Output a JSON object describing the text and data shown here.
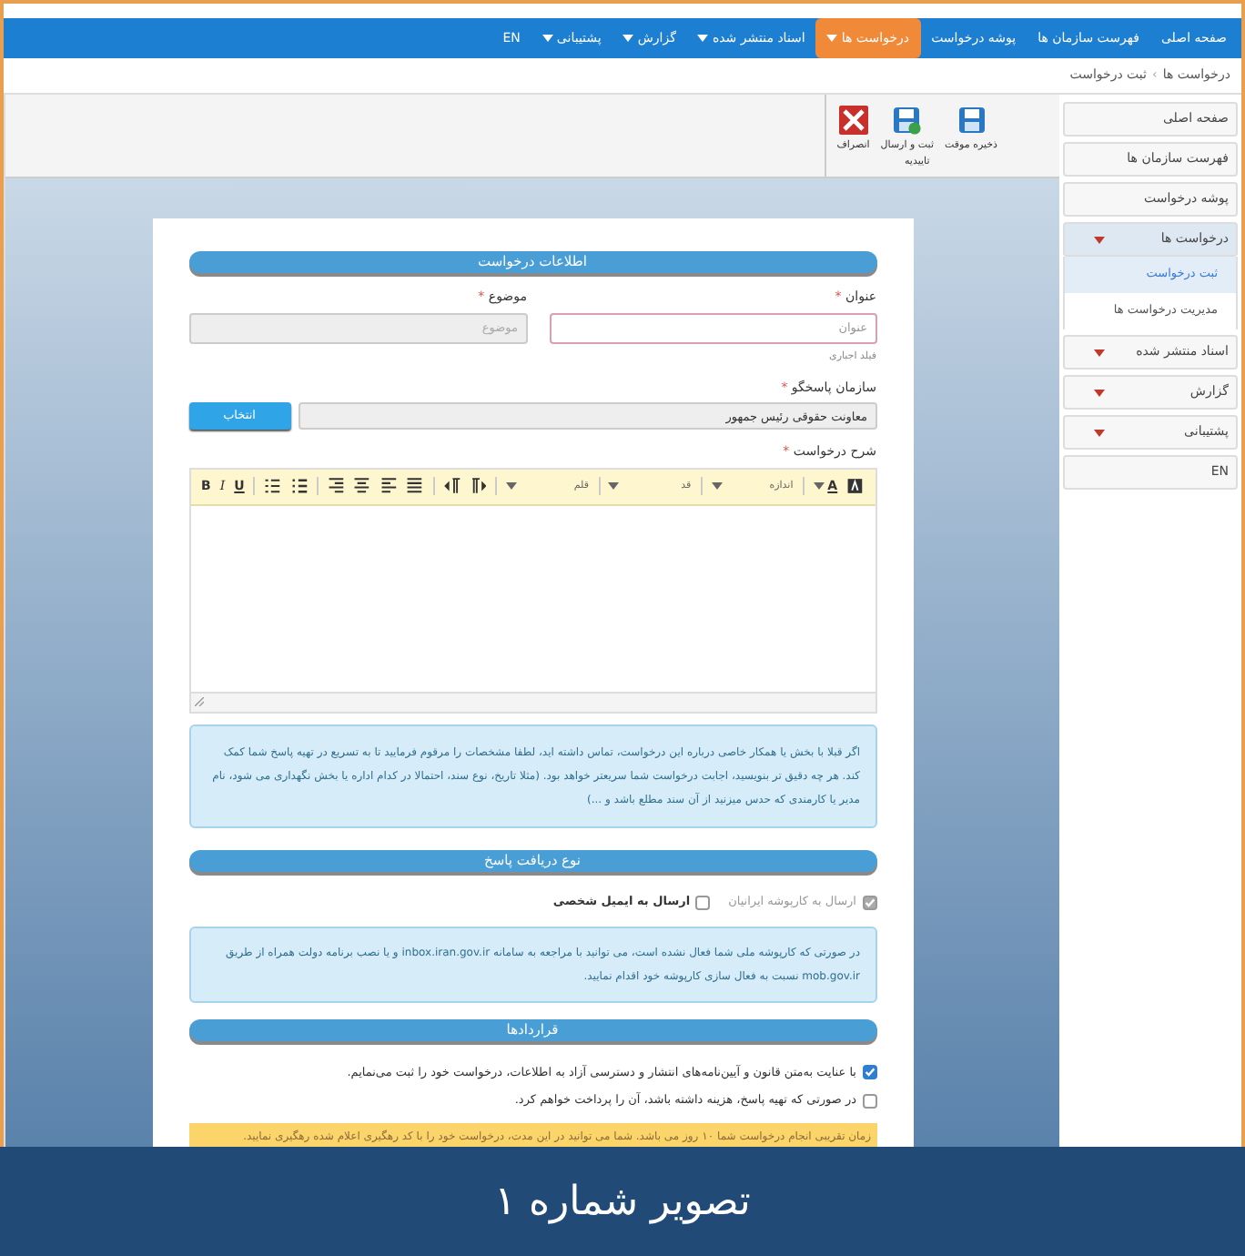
{
  "nav": {
    "items": [
      {
        "label": "صفحه اصلی",
        "dropdown": false,
        "selected": false
      },
      {
        "label": "فهرست سازمان ها",
        "dropdown": false,
        "selected": false
      },
      {
        "label": "پوشه درخواست",
        "dropdown": false,
        "selected": false
      },
      {
        "label": "درخواست ها",
        "dropdown": true,
        "selected": true
      },
      {
        "label": "اسناد منتشر شده",
        "dropdown": true,
        "selected": false
      },
      {
        "label": "گزارش",
        "dropdown": true,
        "selected": false
      },
      {
        "label": "پشتیبانی",
        "dropdown": true,
        "selected": false
      },
      {
        "label": "EN",
        "dropdown": false,
        "selected": false
      }
    ]
  },
  "breadcrumb": {
    "items": [
      "درخواست ها",
      "ثبت درخواست"
    ],
    "separator": "›"
  },
  "toolbar": {
    "buttons": [
      {
        "label": "ذخیره موقت",
        "kind": "save"
      },
      {
        "label": "ثبت و ارسال",
        "kind": "send"
      },
      {
        "label": "انصراف",
        "kind": "cancel"
      }
    ],
    "group_label": "تاییدیه"
  },
  "sidebar": {
    "items": [
      {
        "label": "صفحه اصلی",
        "expanded": false,
        "dropdown": false
      },
      {
        "label": "فهرست سازمان ها",
        "expanded": false,
        "dropdown": false
      },
      {
        "label": "پوشه درخواست",
        "expanded": false,
        "dropdown": false
      },
      {
        "label": "درخواست ها",
        "expanded": true,
        "dropdown": true,
        "children": [
          {
            "label": "ثبت درخواست",
            "selected": true
          },
          {
            "label": "مدیریت درخواست ها",
            "selected": false
          }
        ]
      },
      {
        "label": "اسناد منتشر شده",
        "expanded": false,
        "dropdown": true
      },
      {
        "label": "گزارش",
        "expanded": false,
        "dropdown": true
      },
      {
        "label": "پشتیبانی",
        "expanded": false,
        "dropdown": true
      },
      {
        "label": "EN",
        "expanded": false,
        "dropdown": false
      }
    ]
  },
  "form": {
    "request_section": {
      "title": "اطلاعات درخواست",
      "title_field": {
        "label": "عنوان",
        "required_mark": "*",
        "placeholder": "عنوان",
        "hint": "فیلد اجباری"
      },
      "subject_field": {
        "label": "موضوع",
        "required_mark": "*",
        "placeholder": "موضوع"
      },
      "org_field": {
        "label": "سازمان پاسخگو",
        "required_mark": "*",
        "value": "معاونت حقوقی رئیس جمهور",
        "button": "انتخاب"
      },
      "description": {
        "label": "شرح درخواست",
        "required_mark": "*",
        "editor_toolbar": [
          {
            "kind": "highlight"
          },
          {
            "kind": "color",
            "text": "A"
          },
          {
            "kind": "sep"
          },
          {
            "kind": "select",
            "text": "اندازه"
          },
          {
            "kind": "sep"
          },
          {
            "kind": "select",
            "text": "قد"
          },
          {
            "kind": "sep"
          },
          {
            "kind": "select",
            "text": "قلم"
          },
          {
            "kind": "sep"
          },
          {
            "kind": "rtl"
          },
          {
            "kind": "ltr"
          },
          {
            "kind": "sep"
          },
          {
            "kind": "justify"
          },
          {
            "kind": "alignleft"
          },
          {
            "kind": "aligncenter"
          },
          {
            "kind": "alignright"
          },
          {
            "kind": "sep"
          },
          {
            "kind": "bullets"
          },
          {
            "kind": "numbered"
          },
          {
            "kind": "sep"
          },
          {
            "kind": "underline",
            "text": "U"
          },
          {
            "kind": "italic",
            "text": "I"
          },
          {
            "kind": "bold",
            "text": "B"
          }
        ]
      },
      "info": "اگر قبلا با بخش یا همکار خاصی درباره این درخواست، تماس داشته اید، لطفا مشخصات را مرقوم فرمایید تا به تسریع در تهیه پاسخ شما کمک کند. هر چه دقیق تر بنویسید، اجابت درخواست شما سریعتر خواهد بود. (مثلا تاریخ، نوع سند، احتمالا در کدام اداره یا بخش نگهداری می شود، نام مدیر یا کارمندی که حدس میزنید از آن سند مطلع باشد و ...)"
    },
    "response_section": {
      "title": "نوع دریافت پاسخ",
      "options": [
        {
          "label": "ارسال به کارپوشه ایرانیان",
          "checked": true,
          "disabled": true
        },
        {
          "label": "ارسال به ایمیل شخصی",
          "checked": false,
          "disabled": false
        }
      ],
      "info": "در صورتی که کارپوشه ملی شما فعال نشده است، می توانید با مراجعه به سامانه inbox.iran.gov.ir و یا نصب برنامه دولت همراه از طریق mob.gov.ir نسبت به فعال سازی کارپوشه خود اقدام نمایید."
    },
    "agreements_section": {
      "title": "قراردادها",
      "items": [
        {
          "label": "با عنایت به‌متن قانون و آیین‌نامه‌های انتشار و دسترسی آزاد به اطلاعات، درخواست خود را ثبت می‌نمایم.",
          "checked": true
        },
        {
          "label": "در صورتی که تهیه پاسخ، هزینه داشته باشد، آن را پرداخت خواهم کرد.",
          "checked": false
        }
      ],
      "note": "زمان تقریبی انجام درخواست شما ۱۰ روز می باشد. شما می توانید در این مدت، درخواست خود را با کد رهگیری اعلام شده رهگیری نمایید."
    }
  },
  "caption": "تصویر شماره ۱"
}
